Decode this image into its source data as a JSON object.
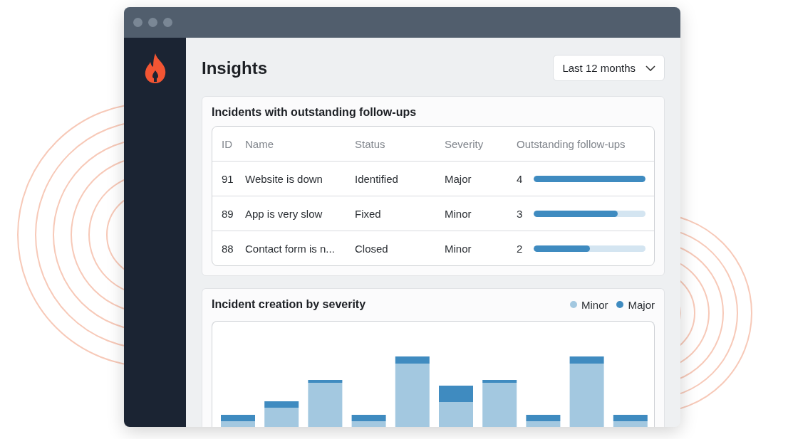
{
  "page": {
    "title": "Insights",
    "period_dropdown": {
      "value": "Last 12 months"
    }
  },
  "followups_card": {
    "title": "Incidents with outstanding follow-ups",
    "columns": [
      "ID",
      "Name",
      "Status",
      "Severity",
      "Outstanding follow-ups"
    ],
    "rows": [
      {
        "id": "91",
        "name": "Website is down",
        "status": "Identified",
        "severity": "Major",
        "count": "4",
        "level": 1.0
      },
      {
        "id": "89",
        "name": "App is very slow",
        "status": "Fixed",
        "severity": "Minor",
        "count": "3",
        "level": 0.75
      },
      {
        "id": "88",
        "name": "Contact form is n...",
        "status": "Closed",
        "severity": "Minor",
        "count": "2",
        "level": 0.5
      }
    ]
  },
  "severity_card": {
    "title": "Incident creation by severity",
    "legend": [
      {
        "label": "Minor",
        "color": "#a3c8e0"
      },
      {
        "label": "Major",
        "color": "#3f8bc0"
      }
    ]
  }
}
